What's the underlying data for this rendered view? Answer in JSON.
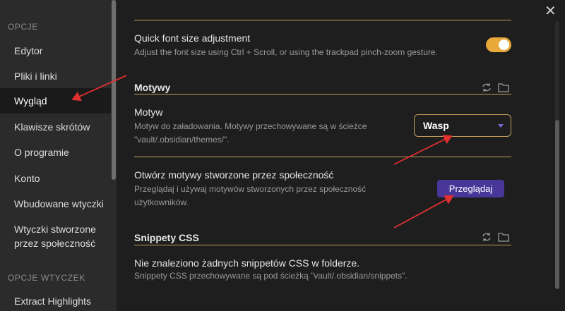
{
  "sidebar": {
    "section_options": "OPCJE",
    "items": [
      {
        "label": "Edytor"
      },
      {
        "label": "Pliki i linki"
      },
      {
        "label": "Wygląd"
      },
      {
        "label": "Klawisze skrótów"
      },
      {
        "label": "O programie"
      },
      {
        "label": "Konto"
      },
      {
        "label": "Wbudowane wtyczki"
      },
      {
        "label": "Wtyczki stworzone przez społeczność"
      }
    ],
    "section_plugins": "OPCJE WTYCZEK",
    "plugin_items": [
      {
        "label": "Extract Highlights"
      }
    ]
  },
  "main": {
    "close_symbol": "✕",
    "font_size": {
      "title": "Quick font size adjustment",
      "description": "Adjust the font size using Ctrl + Scroll, or using the trackpad pinch-zoom gesture.",
      "enabled": true
    },
    "themes_section": {
      "heading": "Motywy",
      "theme_title": "Motyw",
      "theme_description": "Motyw do załadowania. Motywy przechowywane są w ścieżce \"vault/.obsidian/themes/\".",
      "theme_value": "Wasp",
      "community_title": "Otwórz motywy stworzone przez społeczność",
      "community_description": "Przeglądaj i używaj motywów stworzonych przez społeczność użytkowników.",
      "browse_label": "Przeglądaj"
    },
    "snippets_section": {
      "heading": "Snippety CSS",
      "empty_title": "Nie znaleziono żadnych snippetów CSS w folderze.",
      "empty_description": "Snippety CSS przechowywane są pod ścieżką \"vault/.obsidian/snippets\"."
    }
  },
  "colors": {
    "accent": "#c59d5c",
    "toggle_on": "#e8a93a",
    "button": "#483699",
    "annotation_arrow": "#e03030"
  }
}
